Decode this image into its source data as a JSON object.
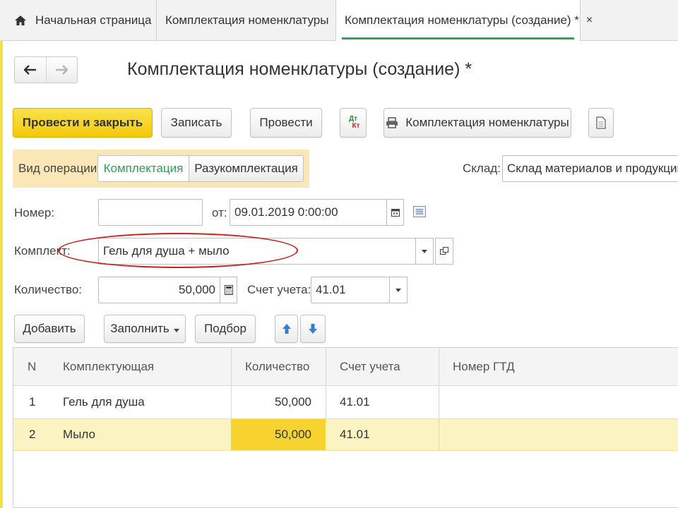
{
  "tabs": [
    {
      "label": "Начальная страница"
    },
    {
      "label": "Комплектация номенклатуры",
      "close": "×"
    },
    {
      "label": "Комплектация номенклатуры (создание) *",
      "close": "×"
    }
  ],
  "nav": {
    "back": "🡐",
    "forward": "🡒"
  },
  "title": "Комплектация номенклатуры (создание) *",
  "toolbar": {
    "post_close": "Провести и закрыть",
    "save": "Записать",
    "post": "Провести",
    "dtkt_dt": "Дт",
    "dtkt_kt": "Кт",
    "print": "Комплектация номенклатуры"
  },
  "operation": {
    "label": "Вид операции:",
    "options": [
      "Комплектация",
      "Разукомплектация"
    ],
    "selected": "Комплектация"
  },
  "warehouse": {
    "label": "Склад:",
    "value": "Склад материалов и продукции"
  },
  "number": {
    "label": "Номер:",
    "value": ""
  },
  "date": {
    "label": "от:",
    "value": "09.01.2019  0:00:00"
  },
  "kit": {
    "label": "Комплект:",
    "value": "Гель для душа + мыло"
  },
  "quantity": {
    "label": "Количество:",
    "value": "50,000"
  },
  "account": {
    "label": "Счет учета:",
    "value": "41.01"
  },
  "table_toolbar": {
    "add": "Добавить",
    "fill": "Заполнить",
    "select": "Подбор"
  },
  "table": {
    "columns": [
      "N",
      "Комплектующая",
      "Количество",
      "Счет учета",
      "Номер ГТД"
    ],
    "rows": [
      {
        "n": "1",
        "item": "Гель для душа",
        "qty": "50,000",
        "account": "41.01",
        "gtd": ""
      },
      {
        "n": "2",
        "item": "Мыло",
        "qty": "50,000",
        "account": "41.01",
        "gtd": ""
      }
    ]
  },
  "colors": {
    "accent_yellow": "#f5d11b",
    "active_green": "#2e9e58",
    "annotation_red": "#cc1f1f",
    "selected_row": "#fbf3c2"
  },
  "icons": [
    "home-icon",
    "close-icon",
    "back-arrow-icon",
    "forward-arrow-icon",
    "dt-kt-icon",
    "printer-icon",
    "document-icon",
    "calendar-icon",
    "list-icon",
    "dropdown-arrow-icon",
    "open-form-icon",
    "calculator-icon",
    "arrow-up-icon",
    "arrow-down-icon"
  ]
}
